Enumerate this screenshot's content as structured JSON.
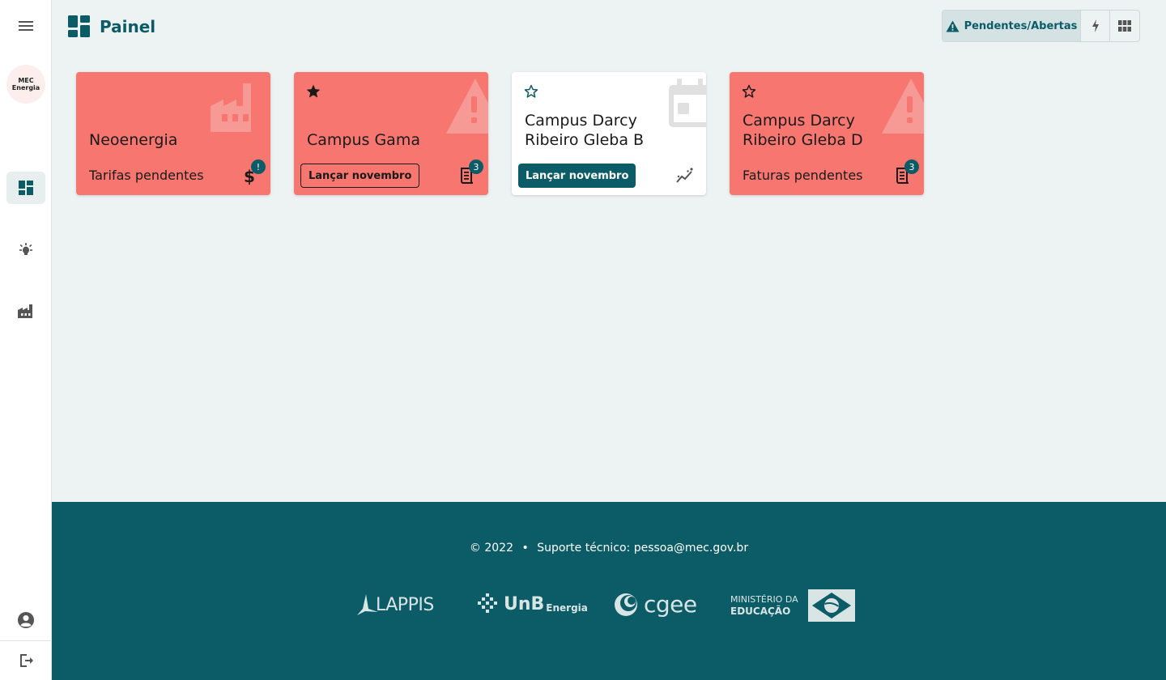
{
  "sidebar": {
    "menu_icon": "menu-icon",
    "logo_line1": "MEC",
    "logo_line2": "Energia",
    "items": [
      {
        "name": "dashboard",
        "icon": "dashboard-icon",
        "active": true
      },
      {
        "name": "consumer-units",
        "icon": "lightbulb-icon",
        "active": false
      },
      {
        "name": "distributors",
        "icon": "factory-icon",
        "active": false
      }
    ],
    "bottom": [
      {
        "name": "account",
        "icon": "account-circle-icon"
      },
      {
        "name": "logout",
        "icon": "logout-icon"
      }
    ]
  },
  "header": {
    "title": "Painel",
    "filter_selected": "Pendentes/Abertas",
    "filter_icons": [
      "warning-icon",
      "bolt-icon",
      "grid-icon"
    ]
  },
  "cards": [
    {
      "name": "Neoenergia",
      "type": "distributor",
      "status": "Tarifas pendentes",
      "badge": "!",
      "color": "#f87670"
    },
    {
      "name": "Campus Gama",
      "starred": true,
      "action": "Lançar novembro",
      "badge": "3",
      "color": "#f87670"
    },
    {
      "name_line1": "Campus Darcy",
      "name_line2": "Ribeiro Gleba B",
      "starred": false,
      "action": "Lançar novembro",
      "color": "#ffffff"
    },
    {
      "name_line1": "Campus Darcy",
      "name_line2": "Ribeiro Gleba D",
      "starred": false,
      "status": "Faturas pendentes",
      "badge": "3",
      "color": "#f87670"
    }
  ],
  "footer": {
    "copyright": "© 2022",
    "separator": "•",
    "support_label": "Suporte técnico:",
    "support_email": "pessoa@mec.gov.br",
    "logos": {
      "lappis": "LAPPIS",
      "unb": "UnB",
      "unb_sub": "Energia",
      "cgee": "cgee",
      "mec_line1": "MINISTÉRIO DA",
      "mec_line2": "EDUCAÇÃO"
    }
  },
  "colors": {
    "primary": "#0b5c66",
    "card_alert": "#f87670",
    "background": "#edf2f2"
  }
}
